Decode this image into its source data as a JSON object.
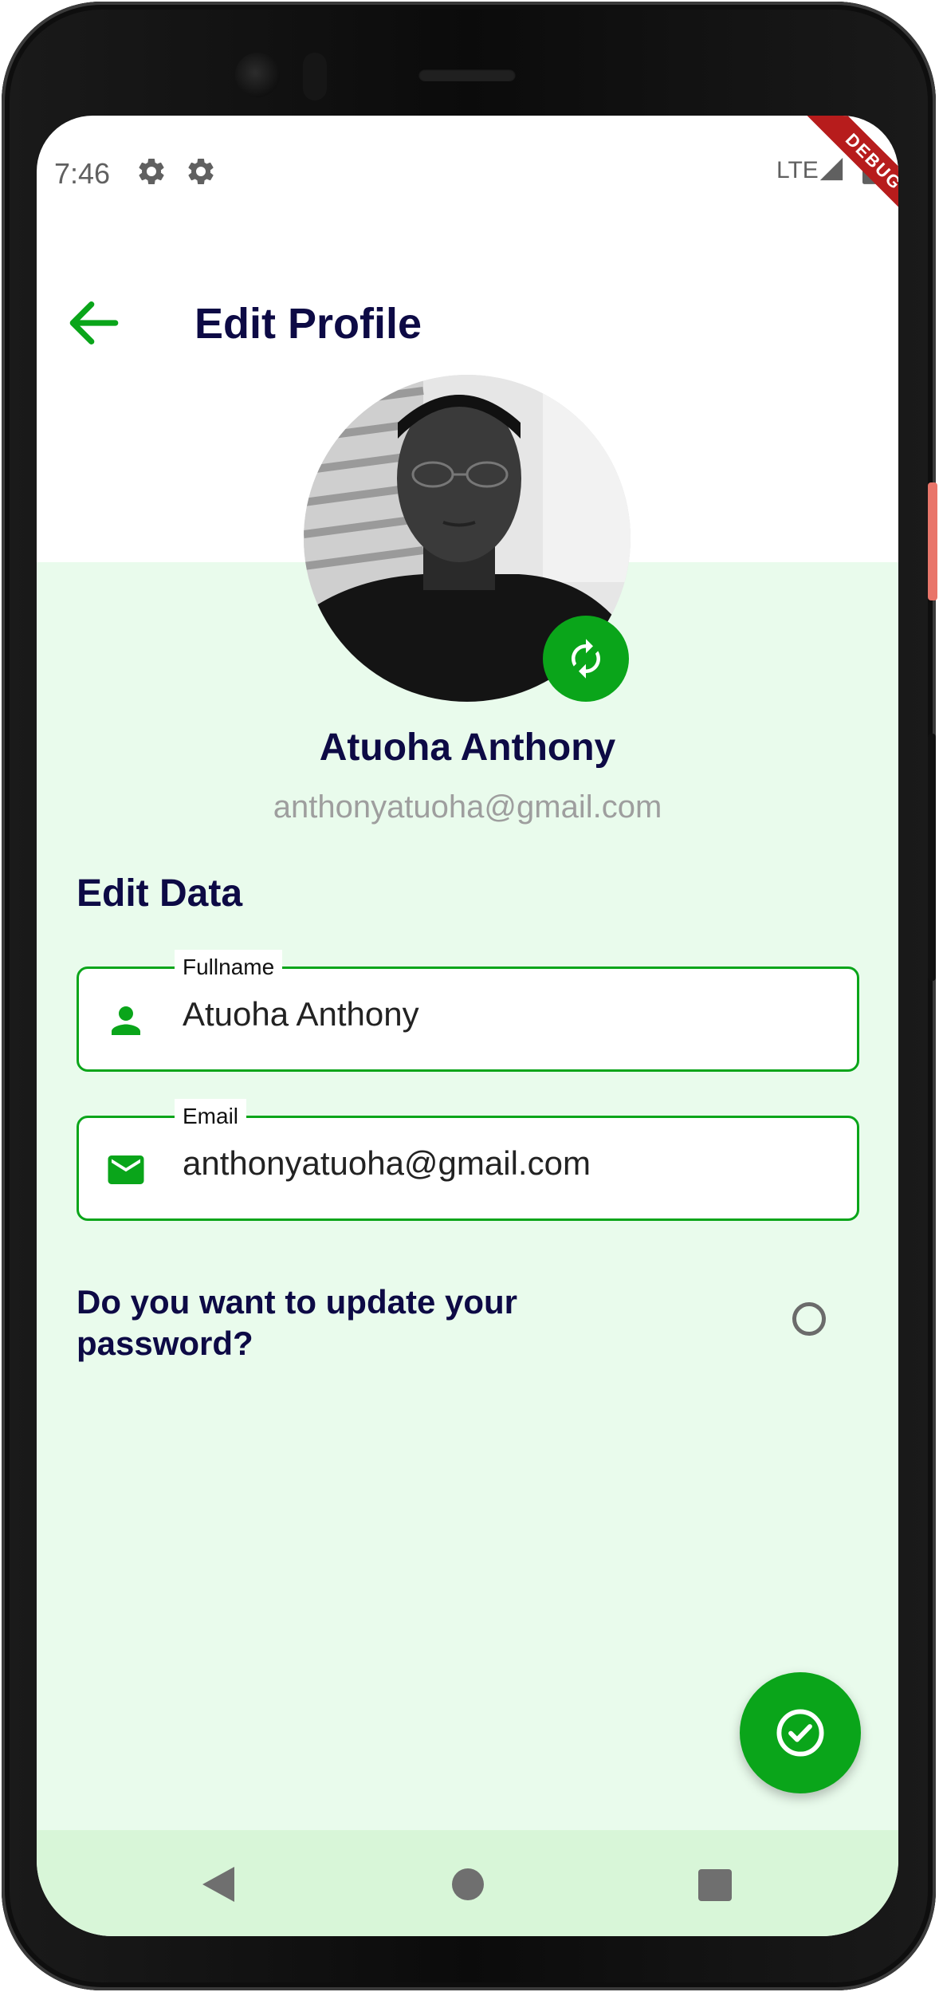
{
  "status_bar": {
    "time": "7:46",
    "network": "LTE",
    "debug_label": "DEBUG",
    "icons": [
      "gear-icon",
      "gear-icon",
      "signal-icon",
      "battery-icon"
    ]
  },
  "header": {
    "title": "Edit Profile",
    "back_icon": "arrow-left-icon"
  },
  "profile": {
    "name": "Atuoha Anthony",
    "email": "anthonyatuoha@gmail.com",
    "change_photo_icon": "refresh-icon"
  },
  "form": {
    "section_title": "Edit Data",
    "fields": [
      {
        "label": "Fullname",
        "value": "Atuoha Anthony",
        "icon": "person-icon"
      },
      {
        "label": "Email",
        "value": "anthonyatuoha@gmail.com",
        "icon": "mail-icon"
      }
    ],
    "password_question": "Do you want to update your password?",
    "password_toggle_checked": false
  },
  "fab": {
    "icon": "check-circle-icon"
  },
  "nav": {
    "icons": [
      "nav-back-icon",
      "nav-home-icon",
      "nav-recents-icon"
    ]
  },
  "colors": {
    "accent": "#0aa51a",
    "title": "#0d0a45",
    "background_tint": "#e9fbec",
    "nav_bar": "#d8f6d8",
    "debug_banner": "#b71c1c"
  }
}
